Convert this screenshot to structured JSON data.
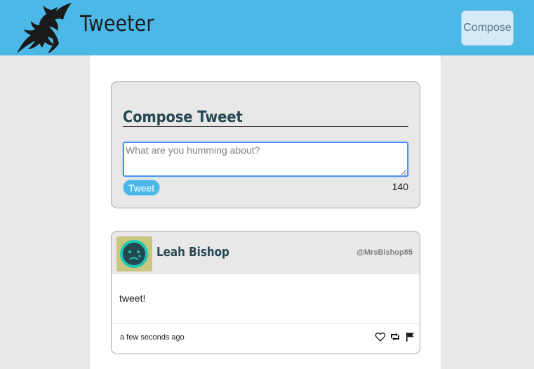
{
  "header": {
    "app_title": "Tweeter",
    "compose_label": "Compose",
    "logo_icon": "dragon-icon",
    "background_color": "#4bb8e8"
  },
  "compose": {
    "heading": "Compose Tweet",
    "input_placeholder": "What are you humming about?",
    "input_value": "",
    "submit_label": "Tweet",
    "char_counter": "140"
  },
  "tweets": [
    {
      "author_name": "Leah Bishop",
      "handle": "@MrsBishop85",
      "avatar_icon": "sad-face-avatar-icon",
      "text": "tweet!",
      "timestamp": "a few seconds ago",
      "actions": [
        "heart-icon",
        "retweet-icon",
        "flag-icon"
      ]
    }
  ],
  "colors": {
    "accent": "#4bb8e8",
    "page_background": "#e8e8e8",
    "heading_text": "#244751"
  }
}
